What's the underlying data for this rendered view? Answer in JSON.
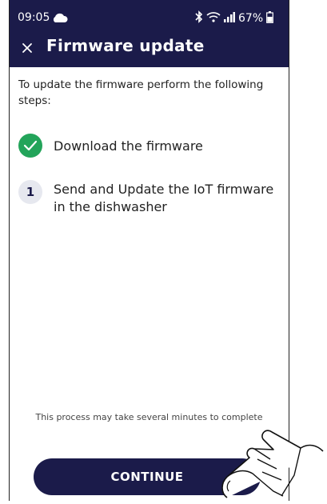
{
  "status_bar": {
    "time": "09:05",
    "battery": "67%",
    "icons": [
      "cloud-icon",
      "bluetooth-icon",
      "wifi-icon",
      "signal-icon",
      "battery-icon"
    ]
  },
  "header": {
    "title": "Firmware update",
    "close_icon": "close-icon",
    "background": "#1b1b4a"
  },
  "intro": "To update the firmware perform the following steps:",
  "steps": [
    {
      "marker": "check",
      "text": "Download the firmware",
      "color": "#23a45a"
    },
    {
      "marker": "1",
      "text": "Send and Update the IoT firmware in the dishwasher"
    }
  ],
  "footer_note": "This process may take several minutes to complete",
  "continue_label": "CONTINUE",
  "pointer_icon": "hand-pointer-icon"
}
